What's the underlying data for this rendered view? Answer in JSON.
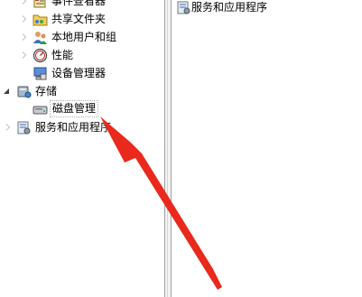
{
  "tree": {
    "event_viewer": {
      "label": "事件查看器",
      "icon": "event-viewer-icon"
    },
    "shared_folders": {
      "label": "共享文件夹",
      "icon": "shared-folder-icon"
    },
    "local_users": {
      "label": "本地用户和组",
      "icon": "users-group-icon"
    },
    "performance": {
      "label": "性能",
      "icon": "performance-gauge-icon"
    },
    "device_manager": {
      "label": "设备管理器",
      "icon": "device-manager-icon"
    },
    "storage": {
      "label": "存储",
      "icon": "storage-icon"
    },
    "disk_management": {
      "label": "磁盘管理",
      "icon": "disk-icon"
    },
    "services_apps": {
      "label": "服务和应用程序",
      "icon": "services-icon"
    }
  },
  "list": {
    "items": [
      {
        "label": "服务和应用程序",
        "icon": "services-icon"
      }
    ]
  },
  "annotation": {
    "arrow_color": "#e8291c",
    "arrow_target": "disk_management"
  }
}
